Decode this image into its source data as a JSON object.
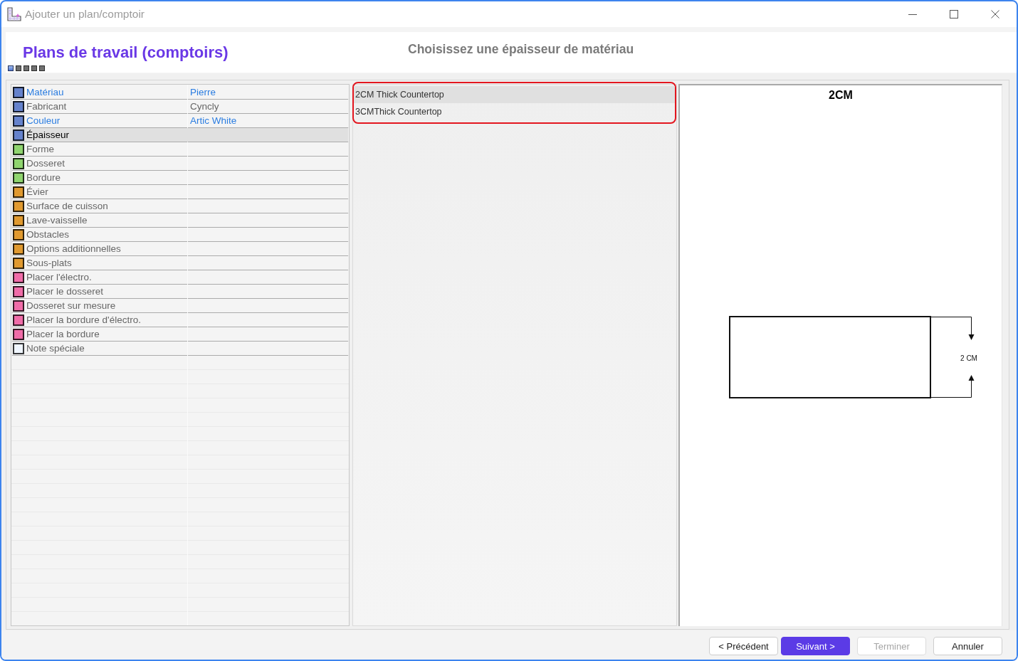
{
  "window": {
    "title": "Ajouter un plan/comptoir"
  },
  "header": {
    "title": "Plans de travail (comptoirs)",
    "subtitle": "Choisissez une épaisseur de matériau",
    "steps": [
      {
        "active": true
      },
      {
        "active": false
      },
      {
        "active": false
      },
      {
        "active": false
      },
      {
        "active": false
      }
    ]
  },
  "categories": [
    {
      "label": "Matériau",
      "value": "Pierre",
      "color": "#6582cc",
      "link": true,
      "selected": false
    },
    {
      "label": "Fabricant",
      "value": "Cyncly",
      "color": "#6582cc",
      "link": false,
      "selected": false
    },
    {
      "label": "Couleur",
      "value": "Artic White",
      "color": "#6582cc",
      "link": true,
      "selected": false
    },
    {
      "label": "Épaisseur",
      "color": "#6582cc",
      "link": false,
      "selected": true
    },
    {
      "label": "Forme",
      "color": "#8fd46e",
      "link": false,
      "selected": false
    },
    {
      "label": "Dosseret",
      "color": "#8fd46e",
      "link": false,
      "selected": false
    },
    {
      "label": "Bordure",
      "color": "#8fd46e",
      "link": false,
      "selected": false
    },
    {
      "label": "Évier",
      "color": "#e0992f",
      "link": false,
      "selected": false
    },
    {
      "label": "Surface de cuisson",
      "color": "#e0992f",
      "link": false,
      "selected": false
    },
    {
      "label": "Lave-vaisselle",
      "color": "#e0992f",
      "link": false,
      "selected": false
    },
    {
      "label": "Obstacles",
      "color": "#e0992f",
      "link": false,
      "selected": false
    },
    {
      "label": "Options additionnelles",
      "color": "#e0992f",
      "link": false,
      "selected": false
    },
    {
      "label": "Sous-plats",
      "color": "#e0992f",
      "link": false,
      "selected": false
    },
    {
      "label": "Placer l'électro.",
      "color": "#f06ca8",
      "link": false,
      "selected": false
    },
    {
      "label": "Placer le dosseret",
      "color": "#f06ca8",
      "link": false,
      "selected": false
    },
    {
      "label": "Dosseret sur mesure",
      "color": "#f06ca8",
      "link": false,
      "selected": false
    },
    {
      "label": "Placer la bordure d'électro.",
      "color": "#f06ca8",
      "link": false,
      "selected": false
    },
    {
      "label": "Placer la bordure",
      "color": "#f06ca8",
      "link": false,
      "selected": false
    },
    {
      "label": "Note spéciale",
      "color": "#f0f6ff",
      "link": false,
      "selected": false
    }
  ],
  "thickness_list": {
    "highlighted": true,
    "options": [
      {
        "label": "2CM Thick Countertop",
        "selected": true
      },
      {
        "label": "3CMThick Countertop",
        "selected": false
      }
    ]
  },
  "preview": {
    "title": "2CM",
    "dimension_label": "2 CM"
  },
  "buttons": [
    {
      "label": "< Précédent",
      "kind": "default",
      "disabled": false
    },
    {
      "label": "Suivant >",
      "kind": "primary",
      "disabled": false
    },
    {
      "label": "Terminer",
      "kind": "default",
      "disabled": true
    },
    {
      "label": "Annuler",
      "kind": "default",
      "disabled": false
    }
  ]
}
